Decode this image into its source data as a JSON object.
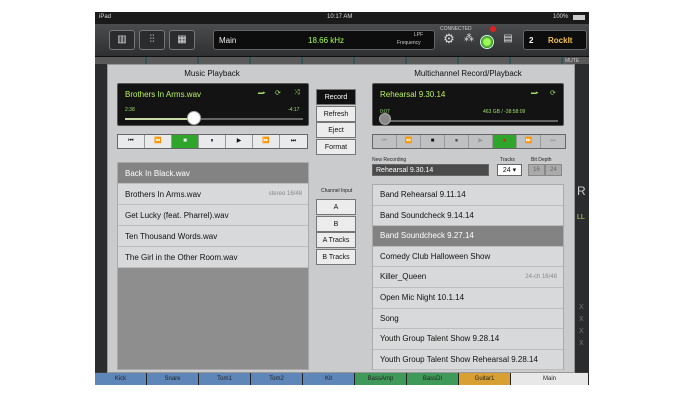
{
  "status_bar": {
    "device": "iPad",
    "time": "10:17 AM",
    "battery": "100%"
  },
  "toolbar": {
    "main_label": "Main",
    "frequency_value": "18.66 kHz",
    "filter_label": "LPF",
    "frequency_label": "Frequency",
    "connected_label": "CONNECTED",
    "scene_number": "2",
    "scene_name": "RockIt",
    "icons": [
      "keyboard-icon",
      "faders-icon",
      "gear-icon",
      "routing-icon",
      "grid-icon"
    ]
  },
  "background": {
    "mute_peek": "MUTE",
    "right_peek_chars": [
      "R",
      "LL",
      "X",
      "X",
      "X",
      "X"
    ]
  },
  "music_playback": {
    "title": "Music Playback",
    "now_playing": "Brothers In Arms.wav",
    "elapsed": "2:38",
    "remaining": "-4:17",
    "progress": 0.39,
    "transport": [
      "⏮",
      "⏪",
      "■",
      "⏸",
      "▶",
      "⏩",
      "⏭"
    ],
    "files": [
      {
        "name": "Back In Black.wav",
        "meta": "",
        "selected": true
      },
      {
        "name": "Brothers In Arms.wav",
        "meta": "stereo 16/48",
        "selected": false
      },
      {
        "name": "Get Lucky (feat. Pharrel).wav",
        "meta": "",
        "selected": false
      },
      {
        "name": "Ten Thousand Words.wav",
        "meta": "",
        "selected": false
      },
      {
        "name": "The Girl in the Other Room.wav",
        "meta": "",
        "selected": false
      }
    ]
  },
  "center_controls": {
    "buttons": [
      "Record",
      "Refresh",
      "Eject",
      "Format"
    ],
    "channel_input_label": "Channel Input",
    "channel_inputs": [
      "A",
      "B",
      "A Tracks",
      "B Tracks"
    ]
  },
  "multichannel": {
    "title": "Multichannel Record/Playback",
    "now_playing": "Rehearsal 9.30.14",
    "elapsed": "0:07",
    "storage": "463 GB / -38:58:09",
    "transport": [
      "⏮",
      "⏪",
      "■",
      "⏸",
      "▶",
      "●",
      "⏩",
      "⏭"
    ],
    "new_recording_label": "New Recording",
    "new_recording_value": "Rehearsal 9.30.14",
    "tracks_label": "Tracks",
    "tracks_value": "24",
    "bit_depth_label": "Bit Depth",
    "bit_depth_options": [
      "16",
      "24"
    ],
    "sessions": [
      {
        "name": "Band Rehearsal 9.11.14",
        "meta": "",
        "selected": false
      },
      {
        "name": "Band Soundcheck 9.14.14",
        "meta": "",
        "selected": false
      },
      {
        "name": "Band Soundcheck 9.27.14",
        "meta": "",
        "selected": true
      },
      {
        "name": "Comedy Club Halloween Show",
        "meta": "",
        "selected": false
      },
      {
        "name": "Killer_Queen",
        "meta": "24-ch 16/48",
        "selected": false
      },
      {
        "name": "Open Mic Night 10.1.14",
        "meta": "",
        "selected": false
      },
      {
        "name": "Song",
        "meta": "",
        "selected": false
      },
      {
        "name": "Youth Group Talent Show 9.28.14",
        "meta": "",
        "selected": false
      },
      {
        "name": "Youth Group Talent Show Rehearsal 9.28.14",
        "meta": "",
        "selected": false
      }
    ]
  },
  "channels": [
    {
      "name": "Kick",
      "color": "#5f86b8"
    },
    {
      "name": "Snare",
      "color": "#5f86b8"
    },
    {
      "name": "Tom1",
      "color": "#5f86b8"
    },
    {
      "name": "Tom2",
      "color": "#5f86b8"
    },
    {
      "name": "Kit",
      "color": "#5f86b8"
    },
    {
      "name": "BassAmp",
      "color": "#3f9a5a"
    },
    {
      "name": "BassDI",
      "color": "#3f9a5a"
    },
    {
      "name": "Guitar1",
      "color": "#d8a032"
    },
    {
      "name": "Main",
      "color": "#e8e8e8"
    }
  ],
  "colors": {
    "accent_green": "#2fa52b",
    "display_text": "#b8f05a",
    "record_red": "#e02020"
  }
}
